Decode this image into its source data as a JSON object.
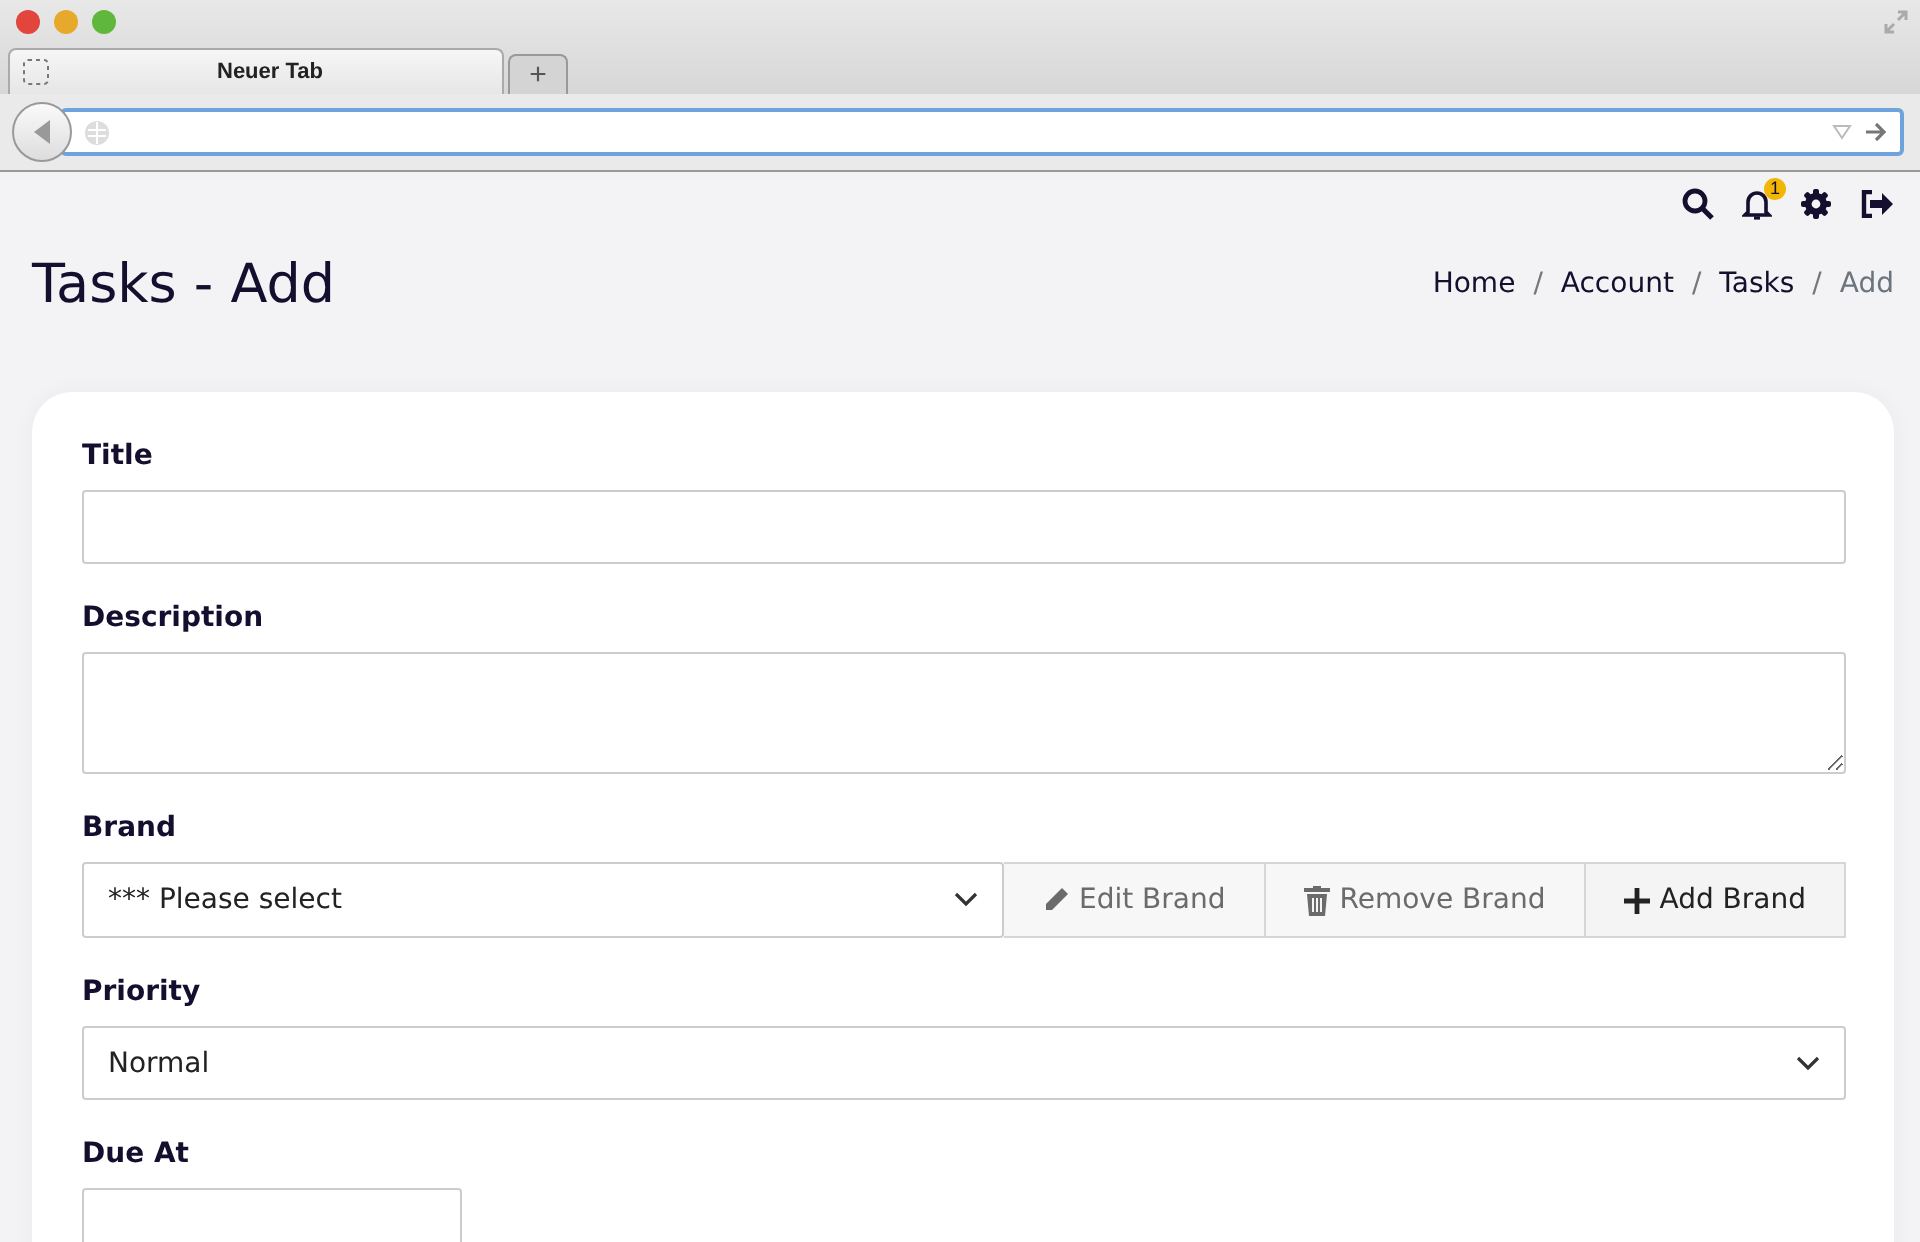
{
  "browser": {
    "tab_title": "Neuer Tab",
    "new_tab": "+"
  },
  "topbar": {
    "notification_count": "1"
  },
  "page": {
    "title": "Tasks - Add"
  },
  "breadcrumb": [
    {
      "label": "Home",
      "current": false,
      "separator": "/"
    },
    {
      "label": "Account",
      "current": false,
      "separator": "/"
    },
    {
      "label": "Tasks",
      "current": false,
      "separator": "/"
    },
    {
      "label": "Add",
      "current": true
    }
  ],
  "form": {
    "fields": [
      {
        "kind": "text",
        "label": "Title"
      },
      {
        "kind": "textarea",
        "label": "Description"
      },
      {
        "kind": "select-group",
        "label": "Brand",
        "value": "*** Please select",
        "buttons": [
          {
            "kind": "edit",
            "label": "Edit Brand",
            "disabled": true
          },
          {
            "kind": "remove",
            "label": "Remove Brand",
            "disabled": true
          },
          {
            "kind": "add",
            "label": "Add Brand",
            "disabled": false
          }
        ]
      },
      {
        "kind": "select",
        "label": "Priority",
        "value": "Normal"
      },
      {
        "kind": "date",
        "label": "Due At"
      }
    ]
  }
}
